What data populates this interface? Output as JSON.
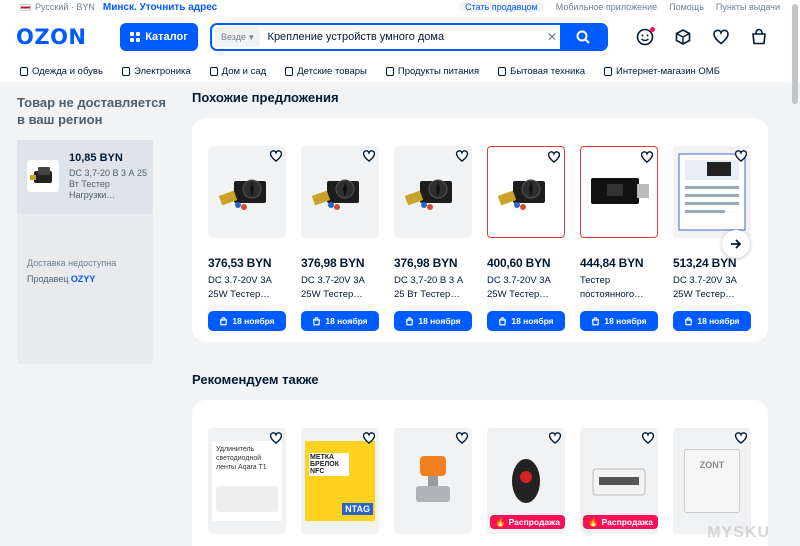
{
  "topbar": {
    "language": "Русский · BYN",
    "region": "Минск. Уточнить адрес",
    "links": [
      "Стать продавцом",
      "Мобильное приложение",
      "Помощь",
      "Пункты выдачи"
    ]
  },
  "header": {
    "logo": "OZON",
    "catalog_label": "Каталог",
    "search_scope": "Везде",
    "search_query": "Крепление устройств умного дома",
    "icons": [
      "profile-icon",
      "orders-icon",
      "favorites-icon",
      "cart-icon"
    ]
  },
  "categories": [
    "Одежда и обувь",
    "Электроника",
    "Дом и сад",
    "Детские товары",
    "Продукты питания",
    "Бытовая техника",
    "Интернет-магазин ОМБ"
  ],
  "sidebar": {
    "title": "Товар не доставляется в ваш регион",
    "product_price": "10,85 BYN",
    "product_name": "DC 3,7-20 В 3 А 25 Вт Тестер Нагрузки…",
    "delivery": "Доставка недоступна",
    "seller_label": "Продавец",
    "seller_name": "OZYY"
  },
  "similar": {
    "title": "Похожие предложения",
    "items": [
      {
        "price": "376,53 BYN",
        "name": "DC 3.7-20V 3A 25W Тестер…",
        "delivery": "18 ноября"
      },
      {
        "price": "376,98 BYN",
        "name": "DC 3.7-20V 3A 25W Тестер…",
        "delivery": "18 ноября"
      },
      {
        "price": "376,98 BYN",
        "name": "DC 3,7-20 В 3 А 25 Вт Тестер…",
        "delivery": "18 ноября"
      },
      {
        "price": "400,60 BYN",
        "name": "DC 3.7-20V 3A 25W Тестер…",
        "delivery": "18 ноября"
      },
      {
        "price": "444,84 BYN",
        "name": "Тестер постоянного…",
        "delivery": "18 ноября"
      },
      {
        "price": "513,24 BYN",
        "name": "DC 3.7-20V 3A 25W Тестер…",
        "delivery": "18 ноября"
      }
    ]
  },
  "recommended": {
    "title": "Рекомендуем также",
    "sale_label": "Распродажа",
    "item1_text": "Удлинитель светодиодной ленты Aqara T1",
    "item2_badge": "МЕТКА БРЕЛОК NFC",
    "item2_tag": "NTAG",
    "item6_brand": "ZONT"
  },
  "watermark": "MYSKU",
  "colors": {
    "brand": "#005bff",
    "sale": "#f91155",
    "text": "#001a34"
  }
}
